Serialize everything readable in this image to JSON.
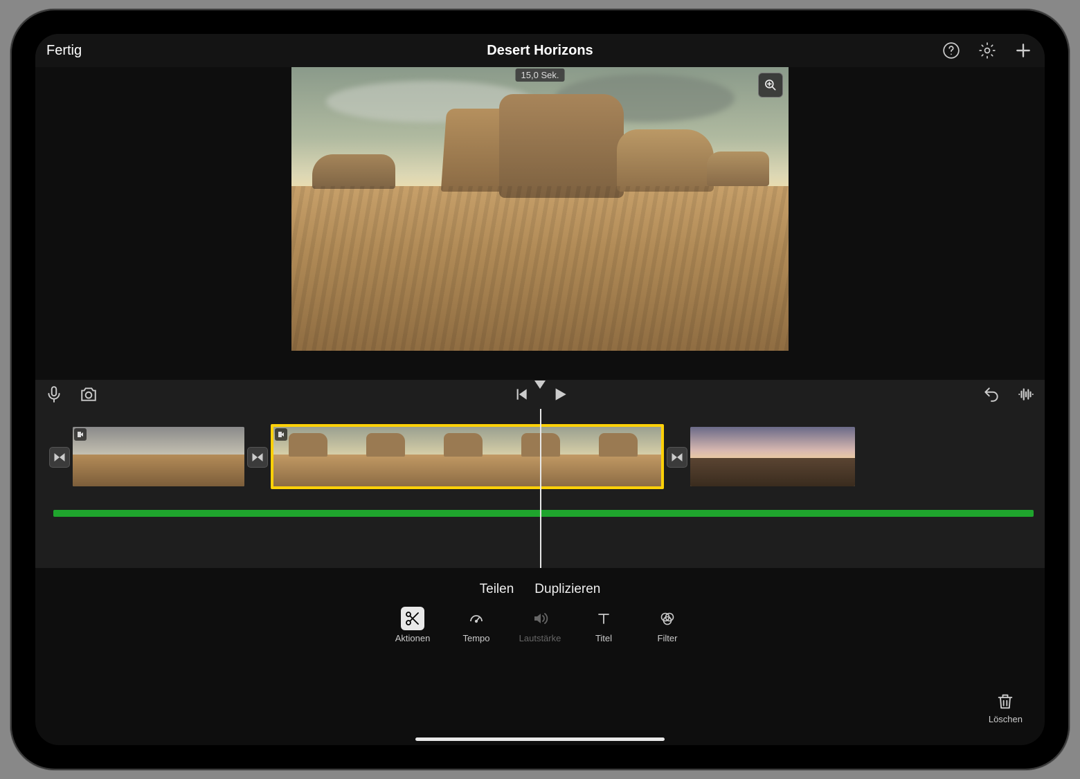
{
  "topbar": {
    "done": "Fertig",
    "title": "Desert Horizons"
  },
  "preview": {
    "duration_label": "15,0 Sek."
  },
  "options": {
    "split": "Teilen",
    "duplicate": "Duplizieren"
  },
  "tabs": {
    "actions": "Aktionen",
    "tempo": "Tempo",
    "volume": "Lautstärke",
    "title": "Titel",
    "filter": "Filter"
  },
  "delete_label": "Löschen",
  "clips": [
    {
      "selected": false,
      "thumbs": 2,
      "variant": "a"
    },
    {
      "selected": true,
      "thumbs": 5,
      "variant": "b"
    },
    {
      "selected": false,
      "thumbs": 2,
      "variant": "c"
    }
  ]
}
